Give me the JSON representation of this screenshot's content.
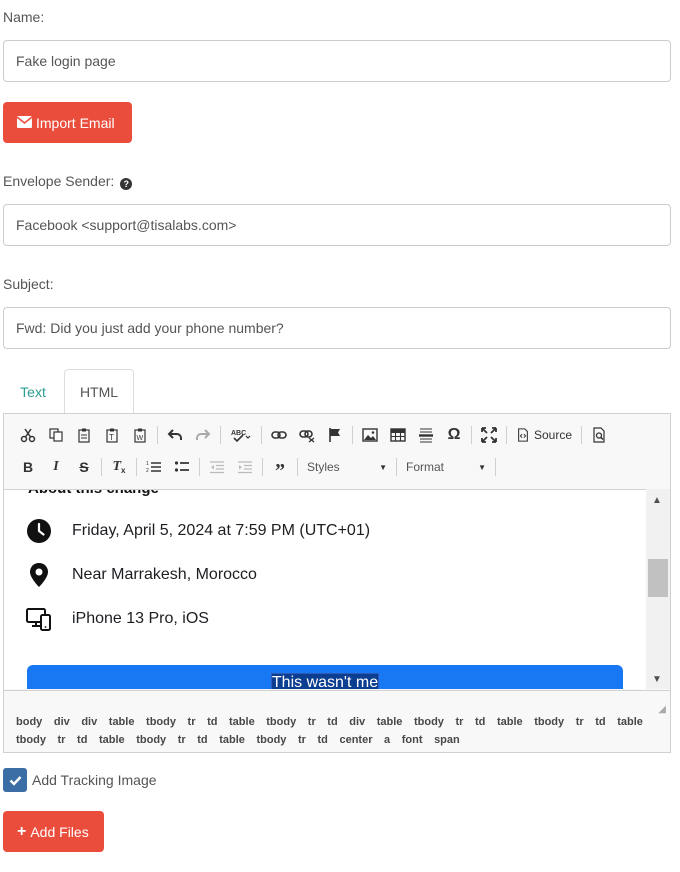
{
  "form": {
    "name_label": "Name:",
    "name_value": "Fake login page",
    "import_email_label": "Import Email",
    "envelope_sender_label": "Envelope Sender:",
    "envelope_sender_value": "Facebook <support@tisalabs.com>",
    "subject_label": "Subject:",
    "subject_value": "Fwd: Did you just add your phone number?",
    "tracking_label": "Add Tracking Image",
    "tracking_checked": true,
    "add_files_label": "Add Files"
  },
  "tabs": {
    "text": "Text",
    "html": "HTML",
    "active": "HTML"
  },
  "editor": {
    "toolbar": {
      "source_label": "Source",
      "styles_label": "Styles",
      "format_label": "Format"
    },
    "content": {
      "heading": "About this change",
      "rows": [
        {
          "icon": "clock-icon",
          "text": "Friday, April 5, 2024 at 7:59 PM (UTC+01)"
        },
        {
          "icon": "location-pin-icon",
          "text": "Near Marrakesh, Morocco"
        },
        {
          "icon": "devices-icon",
          "text": "iPhone 13 Pro, iOS"
        }
      ],
      "button_text": "This wasn't me"
    },
    "path": [
      "body",
      "div",
      "div",
      "table",
      "tbody",
      "tr",
      "td",
      "table",
      "tbody",
      "tr",
      "td",
      "div",
      "table",
      "tbody",
      "tr",
      "td",
      "table",
      "tbody",
      "tr",
      "td",
      "table",
      "tbody",
      "tr",
      "td",
      "table",
      "tbody",
      "tr",
      "td",
      "table",
      "tbody",
      "tr",
      "td",
      "center",
      "a",
      "font",
      "span"
    ]
  },
  "colors": {
    "danger": "#ea4d3c",
    "tab_text": "#2a9d8f",
    "facebook_blue": "#1877f2",
    "checkbox": "#3a6ea5"
  }
}
